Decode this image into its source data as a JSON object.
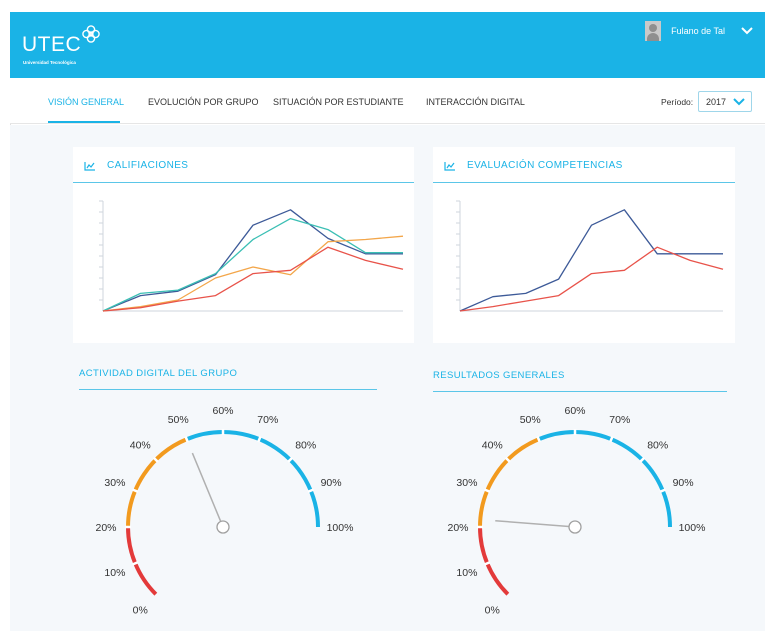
{
  "header": {
    "logo_text": "UTEC",
    "logo_subtitle": "Universidad Tecnológica",
    "user_name": "Fulano de Tal",
    "icons": {
      "logo": "flower-logo-icon",
      "avatar": "user-avatar-icon",
      "menu": "chevron-down-icon"
    }
  },
  "tabs": [
    {
      "label": "VISIÓN GENERAL",
      "active": true
    },
    {
      "label": "EVOLUCIÓN POR GRUPO",
      "active": false
    },
    {
      "label": "SITUACIÓN POR ESTUDIANTE",
      "active": false
    },
    {
      "label": "INTERACCIÓN DIGITAL",
      "active": false
    }
  ],
  "period": {
    "label": "Período:",
    "value": "2017"
  },
  "colors": {
    "accent": "#1ab3e6",
    "navy": "#3d5a98",
    "teal": "#3bbfb4",
    "orange": "#f3a64a",
    "red": "#e8534a",
    "gauge_red": "#e33a3a",
    "gauge_orange": "#f29a1e",
    "gauge_blue": "#1ab3e6"
  },
  "cards": {
    "calificaciones": {
      "title": "CALIFIACIONES",
      "icon": "line-chart-icon"
    },
    "competencias": {
      "title": "EVALUACIÓN COMPETENCIAS",
      "icon": "line-chart-icon"
    }
  },
  "chart_data": [
    {
      "type": "line",
      "title": "CALIFIACIONES",
      "x": [
        0,
        1,
        2,
        3,
        4,
        5,
        6,
        7,
        8
      ],
      "ylim": [
        0,
        100
      ],
      "grid": false,
      "series": [
        {
          "color": "#3d5a98",
          "values": [
            0,
            14,
            18,
            33,
            78,
            92,
            66,
            52,
            52
          ]
        },
        {
          "color": "#3bbfb4",
          "values": [
            0,
            16,
            19,
            34,
            65,
            84,
            74,
            53,
            53
          ]
        },
        {
          "color": "#f3a64a",
          "values": [
            0,
            4,
            10,
            30,
            40,
            33,
            63,
            65,
            68
          ]
        },
        {
          "color": "#e8534a",
          "values": [
            0,
            3,
            9,
            14,
            34,
            37,
            58,
            46,
            38
          ]
        }
      ]
    },
    {
      "type": "line",
      "title": "EVALUACIÓN COMPETENCIAS",
      "x": [
        0,
        1,
        2,
        3,
        4,
        5,
        6,
        7,
        8
      ],
      "ylim": [
        0,
        100
      ],
      "grid": false,
      "series": [
        {
          "color": "#3d5a98",
          "values": [
            0,
            13,
            16,
            29,
            78,
            92,
            52,
            52,
            52
          ]
        },
        {
          "color": "#e8534a",
          "values": [
            0,
            4,
            9,
            14,
            34,
            37,
            58,
            46,
            38
          ]
        }
      ]
    }
  ],
  "gauges": [
    {
      "title": "ACTIVIDAD DIGITAL DEL GRUPO",
      "value_percent": 50
    },
    {
      "title": "RESULTADOS GENERALES",
      "value_percent": 22
    }
  ],
  "gauge_ticks": [
    "0%",
    "10%",
    "20%",
    "30%",
    "40%",
    "50%",
    "60%",
    "70%",
    "80%",
    "90%",
    "100%"
  ]
}
